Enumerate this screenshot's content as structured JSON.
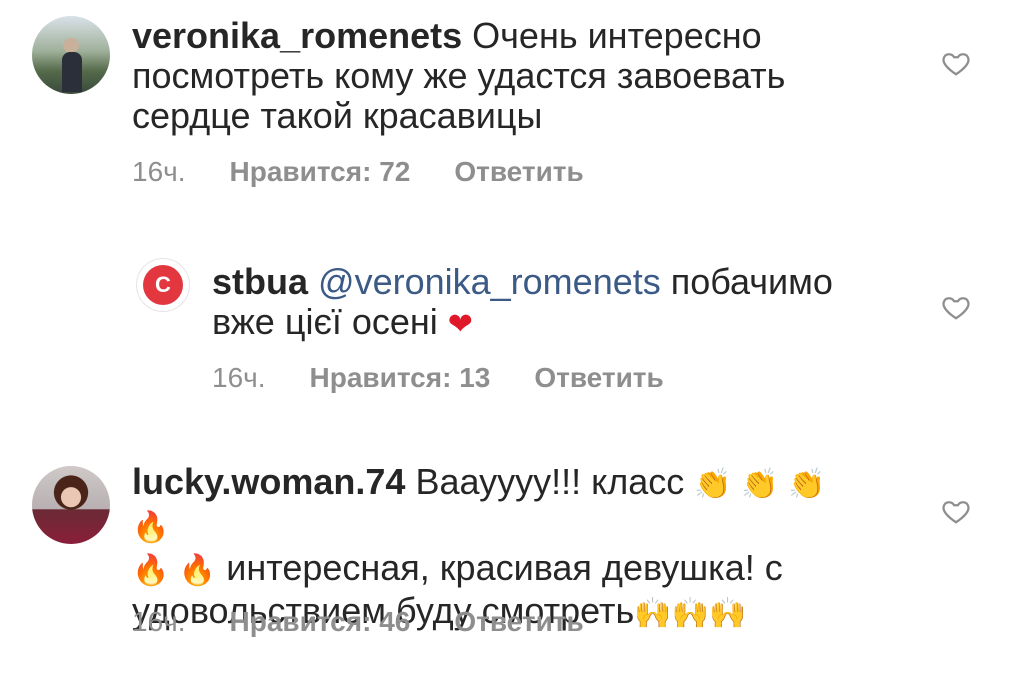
{
  "comments": [
    {
      "username": "veronika_romenets",
      "text": " Очень интересно посмотреть кому же удастся завоевать сердце такой красавицы",
      "time": "16ч.",
      "likes": "Нравится: 72",
      "reply": "Ответить"
    },
    {
      "username": "stbua",
      "mention": "@veronika_romenets",
      "text": " побачимо вже цієї осені ",
      "emoji": "❤",
      "time": "16ч.",
      "likes": "Нравится: 13",
      "reply": "Ответить"
    },
    {
      "username": "lucky.woman.74",
      "text_a": " Ваауууу!!! класс",
      "emoji_a": "👏 👏 👏 🔥",
      "emoji_b": "🔥 🔥",
      "text_b": " интересная, красивая девушка! с удовольствием буду смотреть",
      "emoji_c": "🙌🙌🙌",
      "time": "16ч.",
      "likes": "Нравится: 46",
      "reply": "Ответить"
    }
  ],
  "icons": {
    "like": "heart-outline-icon",
    "brand": "stb-logo-icon"
  },
  "colors": {
    "mention": "#3b5a86",
    "meta": "#8e8e8e",
    "brand": "#e3373f"
  }
}
